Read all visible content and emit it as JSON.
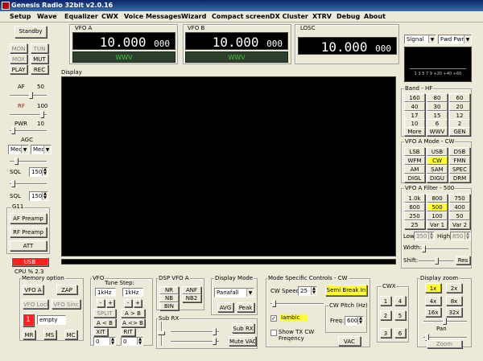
{
  "title": "Genesis Radio 32bit  v2.0.16",
  "menu": [
    "Setup",
    "Wave",
    "Equalizer",
    "CWX",
    "Voice Messages",
    "Wizard",
    "Compact screen",
    "DX Cluster",
    "XTRV",
    "Debug",
    "About"
  ],
  "left": {
    "standby": "Standby",
    "mon": "MON",
    "tun": "TUN",
    "mox": "MOX",
    "mut": "MUT",
    "play": "PLAY",
    "rec": "REC",
    "af_label": "AF",
    "af_value": "50",
    "rf_label": "RF",
    "rf_value": "100",
    "pwr_label": "PWR",
    "pwr_value": "10",
    "agc_label": "AGC",
    "agc1": "Med",
    "agc2": "Med",
    "sql_label": "SQL",
    "sql1": "150",
    "sql2": "150",
    "g11": "G11",
    "af_preamp": "AF Preamp",
    "rf_preamp": "RF Preamp",
    "att": "ATT",
    "usb": "USB",
    "cpu": "CPU % 2.3"
  },
  "vfo_a": {
    "label": "VFO A",
    "freq_main": "10.000",
    "freq_sub": "000",
    "station": "WWV"
  },
  "vfo_b": {
    "label": "VFO B",
    "freq_main": "10.000",
    "freq_sub": "000",
    "station": "WWV"
  },
  "losc": {
    "label": "LOSC",
    "freq_main": "10.000",
    "freq_sub": "000"
  },
  "meter": {
    "mode1": "Signal",
    "mode2": "Fwd Pwr",
    "scale": "1  3  5  7  9  +20 +40 +60"
  },
  "display_label": "Display",
  "band": {
    "title": "Band - HF",
    "buttons": [
      "160",
      "80",
      "60",
      "40",
      "30",
      "20",
      "17",
      "15",
      "12",
      "10",
      "6",
      "2",
      "More",
      "WWV",
      "GEN"
    ]
  },
  "mode": {
    "title": "VFO A Mode - CW",
    "buttons": [
      "LSB",
      "USB",
      "DSB",
      "WFM",
      "CW",
      "FMN",
      "AM",
      "SAM",
      "SPEC",
      "DIGL",
      "DIGU",
      "DRM"
    ]
  },
  "filter": {
    "title": "VFO A Filter - 500",
    "buttons": [
      "1.0k",
      "800",
      "750",
      "600",
      "500",
      "400",
      "250",
      "100",
      "50",
      "25",
      "Var 1",
      "Var 2"
    ],
    "low_label": "Low",
    "low_value": "350",
    "high_label": "High",
    "high_value": "850",
    "width_label": "Width:",
    "shift_label": "Shift:",
    "reset": "Res"
  },
  "memory": {
    "title": "Memory option",
    "vfo_a": "VFO A",
    "zap": "ZAP",
    "vfo_lock": "VFO Lock",
    "vfo_sinc": "VFO Sinc",
    "slot": "1",
    "slot_name": "empty",
    "mr": "MR",
    "ms": "MS",
    "mc": "MC"
  },
  "vfo": {
    "title": "VFO",
    "tune_step": "Tune Step:",
    "step1": "1kHz",
    "step2": "1kHz",
    "minus": "-",
    "plus": "+",
    "split": "SPLIT",
    "a_to_b": "A > B",
    "a_lt_b": "A < B",
    "a_swap_b": "A <> B",
    "xit": "XIT",
    "rit": "RIT",
    "xit_val": "0",
    "rit_val": "0"
  },
  "dsp": {
    "title": "DSP VFO A",
    "nr": "NR",
    "anf": "ANF",
    "nb": "NB",
    "nb2": "NB2",
    "bin": "BIN"
  },
  "display_mode": {
    "title": "Display Mode",
    "value": "Panafall",
    "avg": "AVG",
    "peak": "Peak"
  },
  "subrx": {
    "title": "Sub RX",
    "subrx_btn": "Sub RX",
    "mute_vac": "Mute VAC"
  },
  "cw": {
    "title": "Mode Specific Controls - CW",
    "speed_label": "CW Speed:",
    "speed": "25",
    "semi_break": "Semi Break In",
    "iambic": "Iambic",
    "show_tx": "Show TX CW Freqency",
    "pitch_title": "CW Pitch (Hz)",
    "freq_label": "Freq:",
    "freq": "600",
    "vac": "VAC"
  },
  "cwx": {
    "title": "CWX",
    "buttons": [
      "1",
      "2",
      "3",
      "4",
      "5",
      "6"
    ]
  },
  "zoom": {
    "title": "Display zoom",
    "buttons": [
      "1x",
      "2x",
      "4x",
      "8x",
      "16x",
      "32x"
    ],
    "pan": "Pan",
    "zoom": "Zoom"
  },
  "colors": {
    "active": "#ffff33",
    "usb": "#ff2020",
    "lcd_text": "#ffffff",
    "lcd_sub": "#3fbf3f"
  }
}
